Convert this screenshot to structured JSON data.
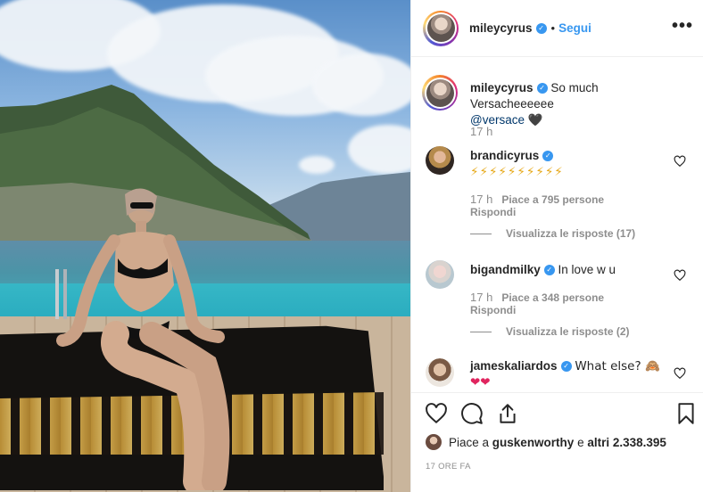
{
  "post": {
    "username": "mileycyrus",
    "verified_icon": "verified-badge-icon",
    "separator": "•",
    "follow_label": "Segui",
    "more_icon": "more-options-icon",
    "more_label": "•••"
  },
  "caption": {
    "username": "mileycyrus",
    "text": "So much Versacheeeeee",
    "mention": "@versace",
    "emoji": "🖤",
    "age": "17 h"
  },
  "comments": [
    {
      "username": "brandicyrus",
      "text": "⚡⚡⚡⚡⚡⚡⚡⚡⚡⚡",
      "age": "17 h",
      "likes": "Piace a 795 persone",
      "reply": "Rispondi",
      "view_replies": "Visualizza le risposte (17)"
    },
    {
      "username": "bigandmilky",
      "text": "In love w u",
      "age": "17 h",
      "likes": "Piace a 348 persone",
      "reply": "Rispondi",
      "view_replies": "Visualizza le risposte (2)"
    },
    {
      "username": "jameskaliardos",
      "text": "What else? 🙈",
      "second_line": "❤❤"
    }
  ],
  "actions": {
    "like_icon": "heart-icon",
    "comment_icon": "comment-icon",
    "share_icon": "share-icon",
    "save_icon": "bookmark-icon"
  },
  "likes_summary": {
    "prefix": "Piace a ",
    "user": "guskenworthy",
    "middle": " e ",
    "others": "altri 2.338.395"
  },
  "timestamp": "17 ORE FA",
  "colors": {
    "accent": "#3897f0",
    "text": "#262626",
    "muted": "#8e8e8e"
  }
}
